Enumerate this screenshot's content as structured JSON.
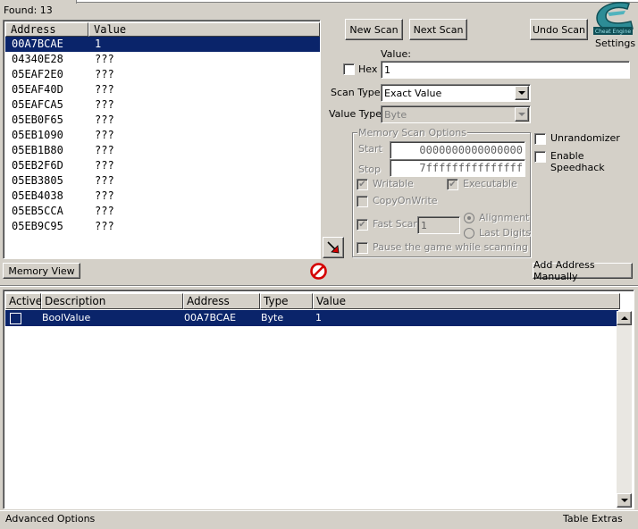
{
  "header": {
    "found_label": "Found: 13"
  },
  "found_list": {
    "columns": [
      "Address",
      "Value"
    ],
    "rows": [
      {
        "address": "00A7BCAE",
        "value": "1"
      },
      {
        "address": "04340E28",
        "value": "???"
      },
      {
        "address": "05EAF2E0",
        "value": "???"
      },
      {
        "address": "05EAF40D",
        "value": "???"
      },
      {
        "address": "05EAFCA5",
        "value": "???"
      },
      {
        "address": "05EB0F65",
        "value": "???"
      },
      {
        "address": "05EB1090",
        "value": "???"
      },
      {
        "address": "05EB1B80",
        "value": "???"
      },
      {
        "address": "05EB2F6D",
        "value": "???"
      },
      {
        "address": "05EB3805",
        "value": "???"
      },
      {
        "address": "05EB4038",
        "value": "???"
      },
      {
        "address": "05EB5CCA",
        "value": "???"
      },
      {
        "address": "05EB9C95",
        "value": "???"
      }
    ]
  },
  "scan": {
    "new_scan": "New Scan",
    "next_scan": "Next Scan",
    "undo_scan": "Undo Scan",
    "settings": "Settings",
    "value_label": "Value:",
    "hex_label": "Hex",
    "value": "1",
    "scan_type_label": "Scan Type",
    "scan_type_value": "Exact Value",
    "value_type_label": "Value Type",
    "value_type_value": "Byte"
  },
  "memory_options": {
    "title": "Memory Scan Options",
    "start_label": "Start",
    "start_value": "0000000000000000",
    "stop_label": "Stop",
    "stop_value": "7fffffffffffffff",
    "writable": "Writable",
    "executable": "Executable",
    "copy_on_write": "CopyOnWrite",
    "fast_scan": "Fast Scan",
    "fast_scan_value": "1",
    "alignment": "Alignment",
    "last_digits": "Last Digits",
    "pause": "Pause the game while scanning"
  },
  "extras": {
    "unrandomizer": "Unrandomizer",
    "speedhack": "Enable Speedhack"
  },
  "buttons": {
    "memory_view": "Memory View",
    "add_address": "Add Address Manually"
  },
  "address_table": {
    "columns": [
      "Active",
      "Description",
      "Address",
      "Type",
      "Value"
    ],
    "rows": [
      {
        "description": "BoolValue",
        "address": "00A7BCAE",
        "type": "Byte",
        "value": "1"
      }
    ]
  },
  "status": {
    "advanced": "Advanced Options",
    "table_extras": "Table Extras"
  },
  "colors": {
    "window_bg": "#d4d0c8",
    "selection": "#0a246a",
    "logo_teal": "#2d8c96"
  }
}
